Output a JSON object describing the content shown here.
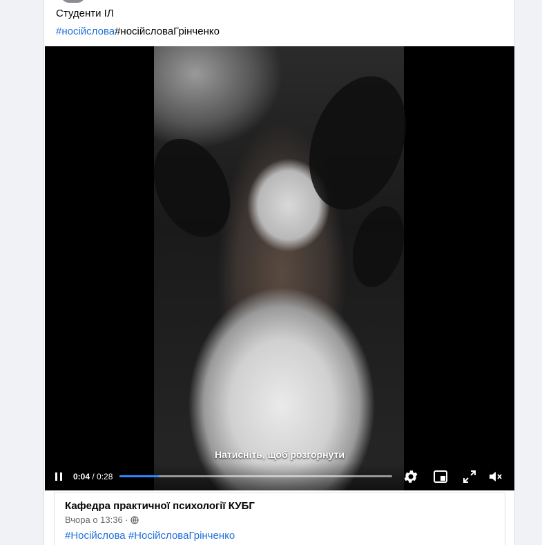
{
  "post": {
    "author_line": "Студенти ІЛ",
    "tags": {
      "tag1": "#носійслова",
      "tag2": "#носійсловаГрінченко"
    }
  },
  "video": {
    "overlay_hint": "Натисніть, щоб розгорнути",
    "time_current": "0:04",
    "time_separator": " / ",
    "time_total": "0:28",
    "progress_fraction": 0.145,
    "muted": true
  },
  "shared_post": {
    "page_name": "Кафедра практичної психології КУБГ",
    "timestamp": "Вчора о 13:36 ·",
    "tags": {
      "tag1": "#Носійслова",
      "tag2": "#НосійсловаГрінченко"
    }
  },
  "icons": [
    "pause-icon",
    "gear-icon",
    "picture-in-picture-icon",
    "fullscreen-icon",
    "volume-muted-icon",
    "globe-icon"
  ],
  "colors": {
    "link": "#216fdb",
    "progress": "#2d88ff",
    "secondary_text": "#65676b"
  }
}
